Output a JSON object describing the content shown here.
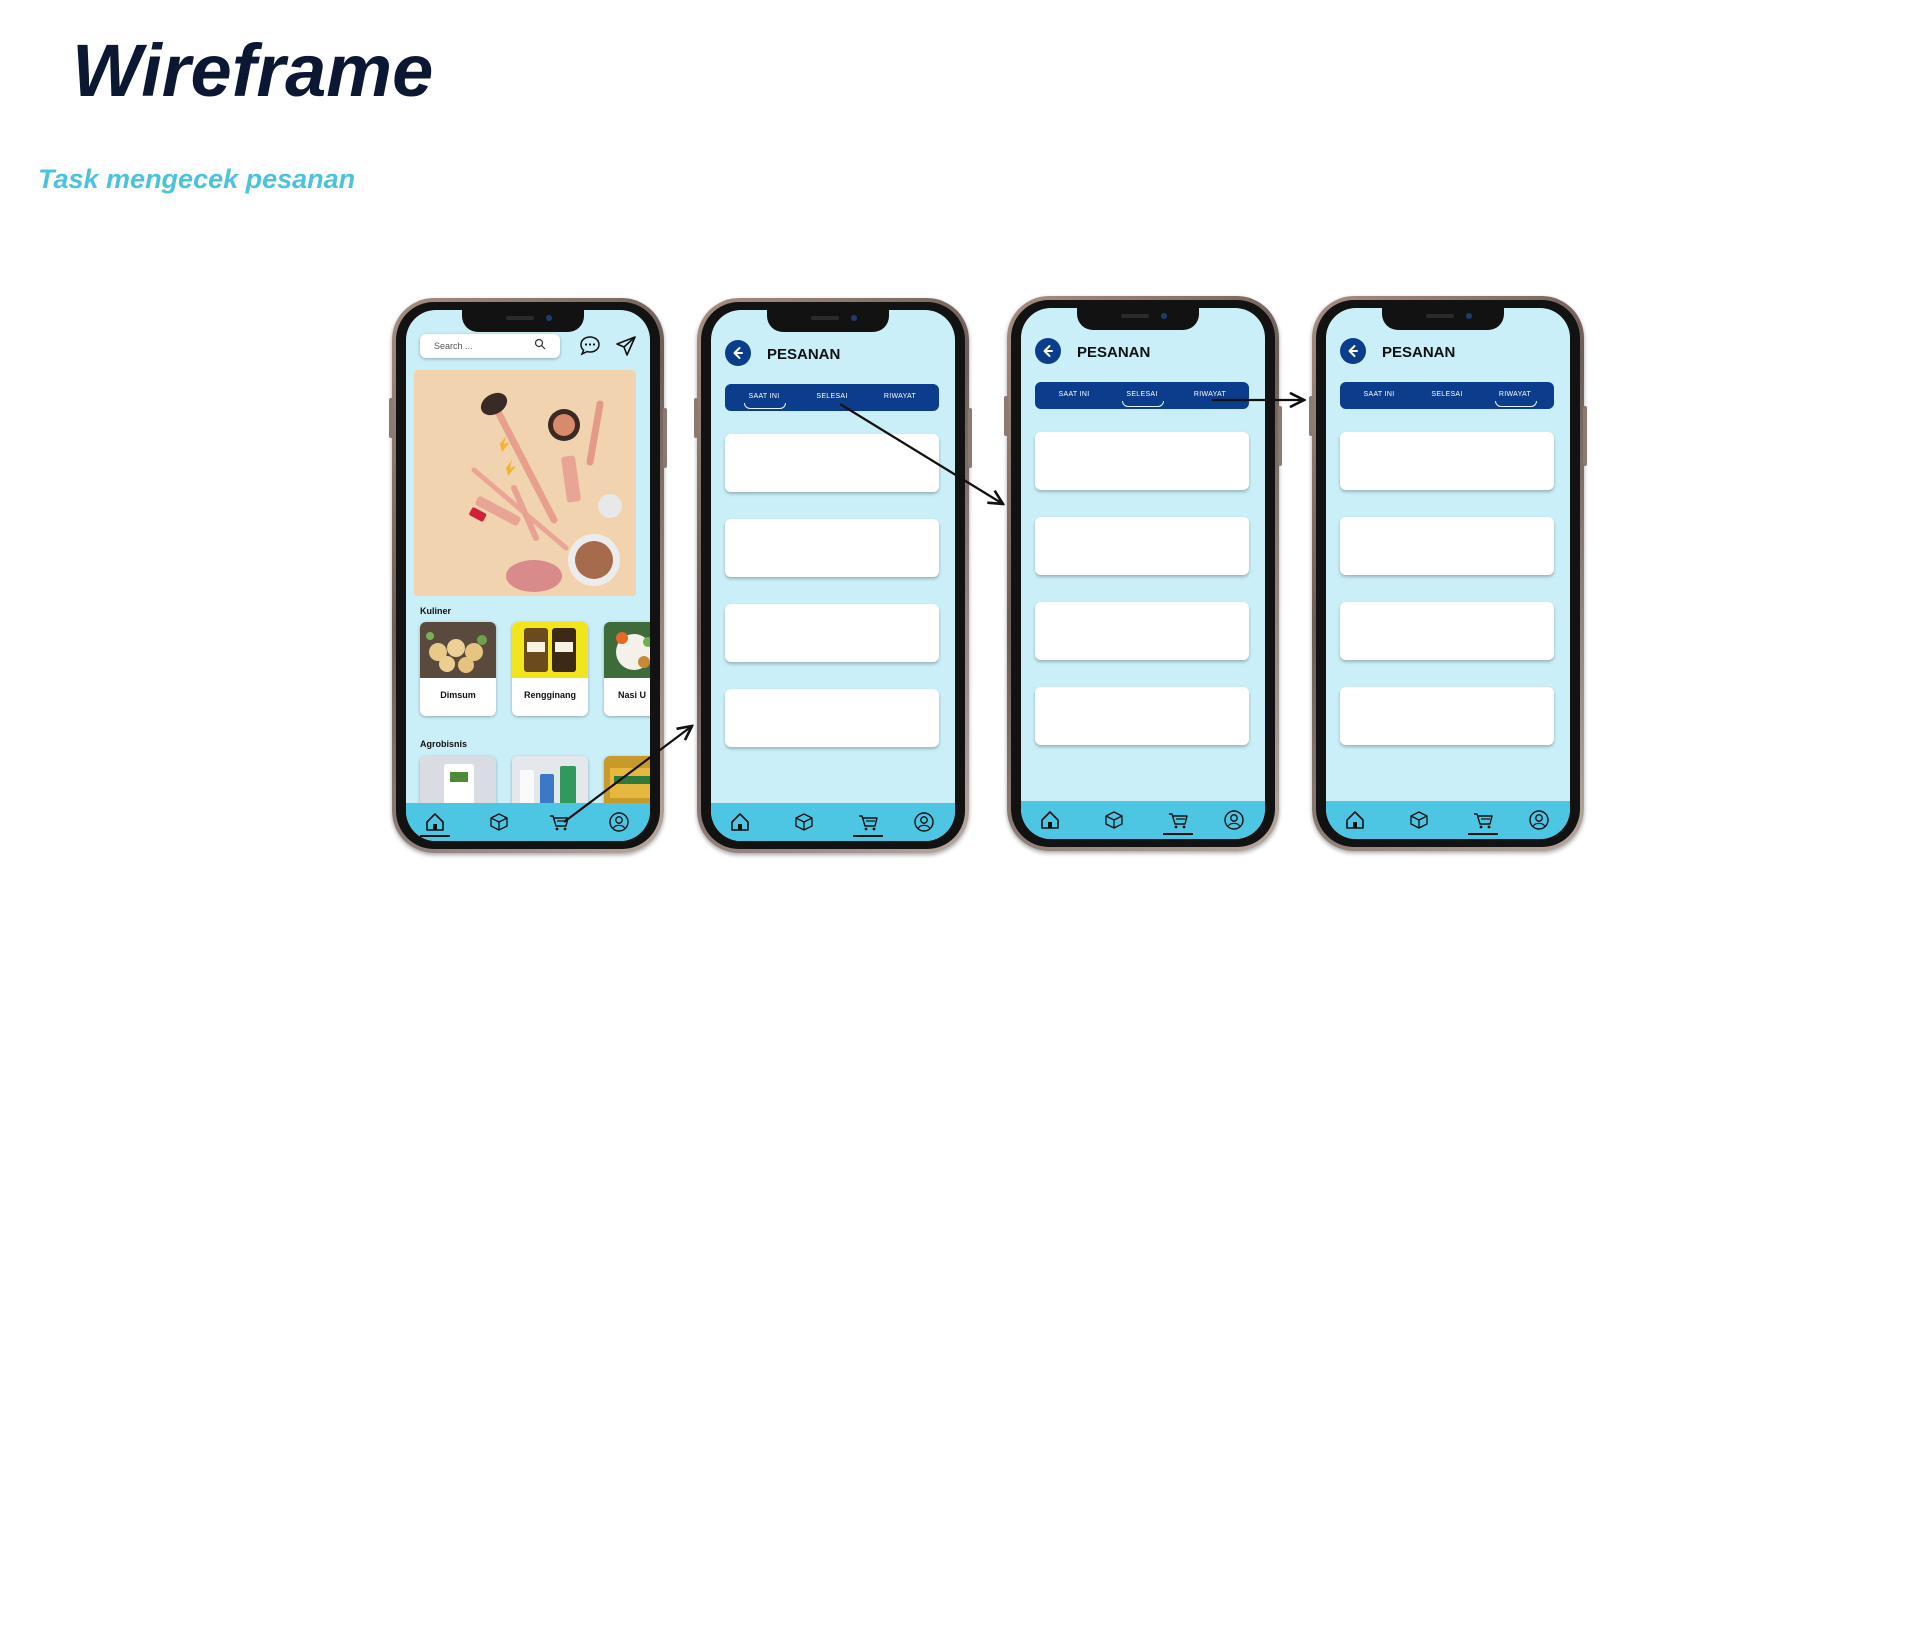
{
  "header": {
    "title": "Wireframe",
    "subtitle": "Task mengecek pesanan"
  },
  "home_screen": {
    "search_placeholder": "Search ...",
    "sections": [
      {
        "label": "Kuliner",
        "items": [
          "Dimsum",
          "Rengginang",
          "Nasi U"
        ]
      },
      {
        "label": "Agrobisnis"
      }
    ],
    "nav_active": "home"
  },
  "orders_screens": [
    {
      "title": "PESANAN",
      "tabs": [
        "SAAT INI",
        "SELESAI",
        "RIWAYAT"
      ],
      "active_tab": "SAAT INI",
      "order_cards": 4,
      "nav_active": "cart"
    },
    {
      "title": "PESANAN",
      "tabs": [
        "SAAT INI",
        "SELESAI",
        "RIWAYAT"
      ],
      "active_tab": "SELESAI",
      "order_cards": 4,
      "nav_active": "cart"
    },
    {
      "title": "PESANAN",
      "tabs": [
        "SAAT INI",
        "SELESAI",
        "RIWAYAT"
      ],
      "active_tab": "RIWAYAT",
      "order_cards": 4,
      "nav_active": "cart"
    }
  ],
  "nav_icons": [
    "home-icon",
    "box-icon",
    "cart-icon",
    "user-icon"
  ],
  "colors": {
    "title": "#0c1733",
    "subtitle": "#4cc3de",
    "screen_bg": "#cbeff8",
    "navbar": "#4dc6e3",
    "tab_bar": "#0b3d8c"
  }
}
